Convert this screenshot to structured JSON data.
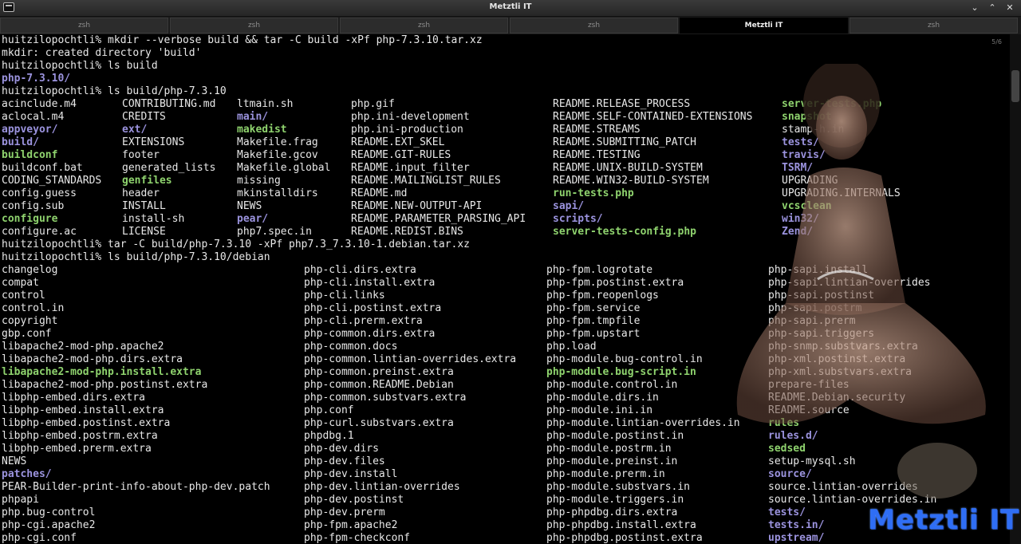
{
  "window": {
    "title": "Metztli IT"
  },
  "tabs": [
    {
      "label": "zsh",
      "active": false
    },
    {
      "label": "zsh",
      "active": false
    },
    {
      "label": "zsh",
      "active": false
    },
    {
      "label": "zsh",
      "active": false
    },
    {
      "label": "Metztli IT",
      "active": true
    },
    {
      "label": "zsh",
      "active": false
    }
  ],
  "scroll_indicator": "5/6",
  "watermark": "Metztli IT",
  "colors": {
    "directory": "#9b93de",
    "executable": "#8fd36e",
    "text": "#e8e8e8",
    "background": "#000000"
  },
  "terminal": {
    "lines": [
      "huitzilopochtli% mkdir --verbose build && tar -C build -xPf php-7.3.10.tar.xz",
      "mkdir: created directory 'build'",
      "huitzilopochtli% ls build",
      "php-7.3.10/",
      "huitzilopochtli% ls build/php-7.3.10"
    ],
    "ls1": [
      [
        {
          "t": "acinclude.m4"
        },
        {
          "t": "CONTRIBUTING.md"
        },
        {
          "t": "ltmain.sh"
        },
        {
          "t": "php.gif"
        },
        {
          "t": "README.RELEASE_PROCESS"
        },
        {
          "t": "server-tests.php",
          "c": "exe"
        }
      ],
      [
        {
          "t": "aclocal.m4"
        },
        {
          "t": "CREDITS"
        },
        {
          "t": "main/",
          "c": "dir"
        },
        {
          "t": "php.ini-development"
        },
        {
          "t": "README.SELF-CONTAINED-EXTENSIONS"
        },
        {
          "t": "snapshot",
          "c": "exe"
        }
      ],
      [
        {
          "t": "appveyor/",
          "c": "dir"
        },
        {
          "t": "ext/",
          "c": "dir"
        },
        {
          "t": "makedist",
          "c": "exe"
        },
        {
          "t": "php.ini-production"
        },
        {
          "t": "README.STREAMS"
        },
        {
          "t": "stamp-h.in"
        }
      ],
      [
        {
          "t": "build/",
          "c": "dir"
        },
        {
          "t": "EXTENSIONS"
        },
        {
          "t": "Makefile.frag"
        },
        {
          "t": "README.EXT_SKEL"
        },
        {
          "t": "README.SUBMITTING_PATCH"
        },
        {
          "t": "tests/",
          "c": "dir"
        }
      ],
      [
        {
          "t": "buildconf",
          "c": "exe"
        },
        {
          "t": "footer"
        },
        {
          "t": "Makefile.gcov"
        },
        {
          "t": "README.GIT-RULES"
        },
        {
          "t": "README.TESTING"
        },
        {
          "t": "travis/",
          "c": "dir"
        }
      ],
      [
        {
          "t": "buildconf.bat"
        },
        {
          "t": "generated_lists"
        },
        {
          "t": "Makefile.global"
        },
        {
          "t": "README.input_filter"
        },
        {
          "t": "README.UNIX-BUILD-SYSTEM"
        },
        {
          "t": "TSRM/",
          "c": "dir"
        }
      ],
      [
        {
          "t": "CODING_STANDARDS"
        },
        {
          "t": "genfiles",
          "c": "exe"
        },
        {
          "t": "missing"
        },
        {
          "t": "README.MAILINGLIST_RULES"
        },
        {
          "t": "README.WIN32-BUILD-SYSTEM"
        },
        {
          "t": "UPGRADING"
        }
      ],
      [
        {
          "t": "config.guess"
        },
        {
          "t": "header"
        },
        {
          "t": "mkinstalldirs"
        },
        {
          "t": "README.md"
        },
        {
          "t": "run-tests.php",
          "c": "exe"
        },
        {
          "t": "UPGRADING.INTERNALS"
        }
      ],
      [
        {
          "t": "config.sub"
        },
        {
          "t": "INSTALL"
        },
        {
          "t": "NEWS"
        },
        {
          "t": "README.NEW-OUTPUT-API"
        },
        {
          "t": "sapi/",
          "c": "dir"
        },
        {
          "t": "vcsclean",
          "c": "exe"
        }
      ],
      [
        {
          "t": "configure",
          "c": "exe"
        },
        {
          "t": "install-sh"
        },
        {
          "t": "pear/",
          "c": "dir"
        },
        {
          "t": "README.PARAMETER_PARSING_API"
        },
        {
          "t": "scripts/",
          "c": "dir"
        },
        {
          "t": "win32/",
          "c": "dir"
        }
      ],
      [
        {
          "t": "configure.ac"
        },
        {
          "t": "LICENSE"
        },
        {
          "t": "php7.spec.in"
        },
        {
          "t": "README.REDIST.BINS"
        },
        {
          "t": "server-tests-config.php",
          "c": "exe"
        },
        {
          "t": "Zend/",
          "c": "dir"
        }
      ]
    ],
    "lines2": [
      "huitzilopochtli% tar -C build/php-7.3.10 -xPf php7.3_7.3.10-1.debian.tar.xz",
      "huitzilopochtli% ls build/php-7.3.10/debian"
    ],
    "ls2": [
      [
        {
          "t": "changelog"
        },
        {
          "t": "php-cli.dirs.extra"
        },
        {
          "t": "php-fpm.logrotate"
        },
        {
          "t": "php-sapi.install"
        }
      ],
      [
        {
          "t": "compat"
        },
        {
          "t": "php-cli.install.extra"
        },
        {
          "t": "php-fpm.postinst.extra"
        },
        {
          "t": "php-sapi.lintian-overrides"
        }
      ],
      [
        {
          "t": "control"
        },
        {
          "t": "php-cli.links"
        },
        {
          "t": "php-fpm.reopenlogs"
        },
        {
          "t": "php-sapi.postinst"
        }
      ],
      [
        {
          "t": "control.in"
        },
        {
          "t": "php-cli.postinst.extra"
        },
        {
          "t": "php-fpm.service"
        },
        {
          "t": "php-sapi.postrm"
        }
      ],
      [
        {
          "t": "copyright"
        },
        {
          "t": "php-cli.prerm.extra"
        },
        {
          "t": "php-fpm.tmpfile"
        },
        {
          "t": "php-sapi.prerm"
        }
      ],
      [
        {
          "t": "gbp.conf"
        },
        {
          "t": "php-common.dirs.extra"
        },
        {
          "t": "php-fpm.upstart"
        },
        {
          "t": "php-sapi.triggers"
        }
      ],
      [
        {
          "t": "libapache2-mod-php.apache2"
        },
        {
          "t": "php-common.docs"
        },
        {
          "t": "php.load"
        },
        {
          "t": "php-snmp.substvars.extra"
        }
      ],
      [
        {
          "t": "libapache2-mod-php.dirs.extra"
        },
        {
          "t": "php-common.lintian-overrides.extra"
        },
        {
          "t": "php-module.bug-control.in"
        },
        {
          "t": "php-xml.postinst.extra"
        }
      ],
      [
        {
          "t": "libapache2-mod-php.install.extra",
          "c": "exe"
        },
        {
          "t": "php-common.preinst.extra"
        },
        {
          "t": "php-module.bug-script.in",
          "c": "exe"
        },
        {
          "t": "php-xml.substvars.extra"
        }
      ],
      [
        {
          "t": "libapache2-mod-php.postinst.extra"
        },
        {
          "t": "php-common.README.Debian"
        },
        {
          "t": "php-module.control.in"
        },
        {
          "t": "prepare-files"
        }
      ],
      [
        {
          "t": "libphp-embed.dirs.extra"
        },
        {
          "t": "php-common.substvars.extra"
        },
        {
          "t": "php-module.dirs.in"
        },
        {
          "t": "README.Debian.security"
        }
      ],
      [
        {
          "t": "libphp-embed.install.extra"
        },
        {
          "t": "php.conf"
        },
        {
          "t": "php-module.ini.in"
        },
        {
          "t": "README.source"
        }
      ],
      [
        {
          "t": "libphp-embed.postinst.extra"
        },
        {
          "t": "php-curl.substvars.extra"
        },
        {
          "t": "php-module.lintian-overrides.in"
        },
        {
          "t": "rules",
          "c": "exe"
        }
      ],
      [
        {
          "t": "libphp-embed.postrm.extra"
        },
        {
          "t": "phpdbg.1"
        },
        {
          "t": "php-module.postinst.in"
        },
        {
          "t": "rules.d/",
          "c": "dir"
        }
      ],
      [
        {
          "t": "libphp-embed.prerm.extra"
        },
        {
          "t": "php-dev.dirs"
        },
        {
          "t": "php-module.postrm.in"
        },
        {
          "t": "sedsed",
          "c": "exe"
        }
      ],
      [
        {
          "t": "NEWS"
        },
        {
          "t": "php-dev.files"
        },
        {
          "t": "php-module.preinst.in"
        },
        {
          "t": "setup-mysql.sh"
        }
      ],
      [
        {
          "t": "patches/",
          "c": "dir"
        },
        {
          "t": "php-dev.install"
        },
        {
          "t": "php-module.prerm.in"
        },
        {
          "t": "source/",
          "c": "dir"
        }
      ],
      [
        {
          "t": "PEAR-Builder-print-info-about-php-dev.patch"
        },
        {
          "t": "php-dev.lintian-overrides"
        },
        {
          "t": "php-module.substvars.in"
        },
        {
          "t": "source.lintian-overrides"
        }
      ],
      [
        {
          "t": "phpapi"
        },
        {
          "t": "php-dev.postinst"
        },
        {
          "t": "php-module.triggers.in"
        },
        {
          "t": "source.lintian-overrides.in"
        }
      ],
      [
        {
          "t": "php.bug-control"
        },
        {
          "t": "php-dev.prerm"
        },
        {
          "t": "php-phpdbg.dirs.extra"
        },
        {
          "t": "tests/",
          "c": "dir"
        }
      ],
      [
        {
          "t": "php-cgi.apache2"
        },
        {
          "t": "php-fpm.apache2"
        },
        {
          "t": "php-phpdbg.install.extra"
        },
        {
          "t": "tests.in/",
          "c": "dir"
        }
      ],
      [
        {
          "t": "php-cgi.conf"
        },
        {
          "t": "php-fpm-checkconf"
        },
        {
          "t": "php-phpdbg.postinst.extra"
        },
        {
          "t": "upstream/",
          "c": "dir"
        }
      ]
    ]
  }
}
